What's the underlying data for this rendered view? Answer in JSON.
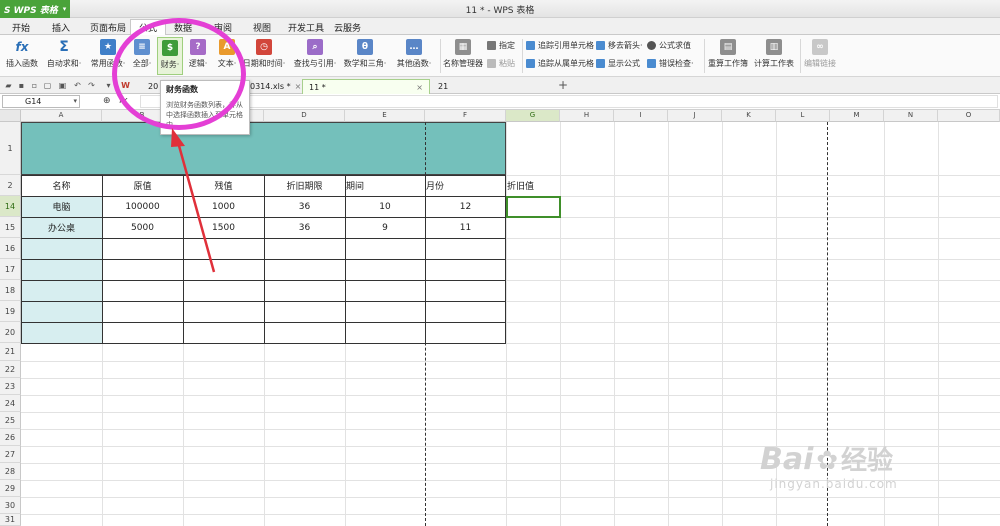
{
  "app": {
    "logo_text": "S WPS 表格",
    "window_title": "11 * - WPS 表格"
  },
  "menu_tabs": [
    "开始",
    "插入",
    "页面布局",
    "公式",
    "数据",
    "审阅",
    "视图",
    "开发工具",
    "云服务"
  ],
  "ribbon": {
    "buttons": [
      {
        "label": "插入函数",
        "icon": "fx-icon"
      },
      {
        "label": "自动求和·",
        "icon": "sigma-icon"
      },
      {
        "label": "常用函数·",
        "icon": "star-book-icon"
      },
      {
        "label": "全部·",
        "icon": "book-icon"
      },
      {
        "label": "财务·",
        "icon": "finance-book-icon"
      },
      {
        "label": "逻辑·",
        "icon": "logic-book-icon"
      },
      {
        "label": "文本·",
        "icon": "text-book-icon"
      },
      {
        "label": "日期和时间·",
        "icon": "date-book-icon"
      },
      {
        "label": "查找与引用·",
        "icon": "lookup-book-icon"
      },
      {
        "label": "数学和三角·",
        "icon": "math-book-icon"
      },
      {
        "label": "其他函数·",
        "icon": "other-book-icon"
      },
      {
        "label": "名称管理器",
        "icon": "name-manager-icon"
      },
      {
        "label": "重算工作簿",
        "icon": "recalc-workbook-icon"
      },
      {
        "label": "计算工作表",
        "icon": "calc-sheet-icon"
      },
      {
        "label": "编辑链接",
        "icon": "edit-links-icon"
      }
    ],
    "small_buttons": [
      "指定",
      "粘贴",
      "追踪引用单元格",
      "追踪从属单元格",
      "移去箭头·",
      "显示公式",
      "公式求值",
      "错误检查·"
    ]
  },
  "doc_tabs": [
    "20",
    "0314.xls *",
    "11 *",
    "21"
  ],
  "formula_bar": {
    "cell_ref": "G14",
    "fx": "fx"
  },
  "tooltip": {
    "title": "财务函数",
    "description": "浏览财务函数列表，并从中选择函数插入至单元格中。"
  },
  "columns": [
    "A",
    "B",
    "C",
    "D",
    "E",
    "F",
    "G",
    "H",
    "I",
    "J",
    "K",
    "L",
    "M",
    "N",
    "O"
  ],
  "rows": [
    "1",
    "2",
    "14",
    "15",
    "16",
    "17",
    "18",
    "19",
    "20",
    "21",
    "22",
    "23",
    "24",
    "25",
    "26",
    "27",
    "28",
    "29",
    "30",
    "31"
  ],
  "table": {
    "headers": [
      "名称",
      "原值",
      "残值",
      "折旧期限",
      "期间",
      "月份",
      "折旧值"
    ],
    "rows": [
      [
        "电脑",
        "100000",
        "1000",
        "36",
        "10",
        "12",
        ""
      ],
      [
        "办公桌",
        "5000",
        "1500",
        "36",
        "9",
        "11",
        ""
      ]
    ]
  },
  "watermark": {
    "main": "Bai",
    "main2": "经验",
    "sub": "jingyan.baidu.com"
  },
  "colors": {
    "accent_green": "#4aa33a",
    "highlight": "#e43fd5",
    "arrow": "#e0303a",
    "teal": "#74c0bb"
  }
}
